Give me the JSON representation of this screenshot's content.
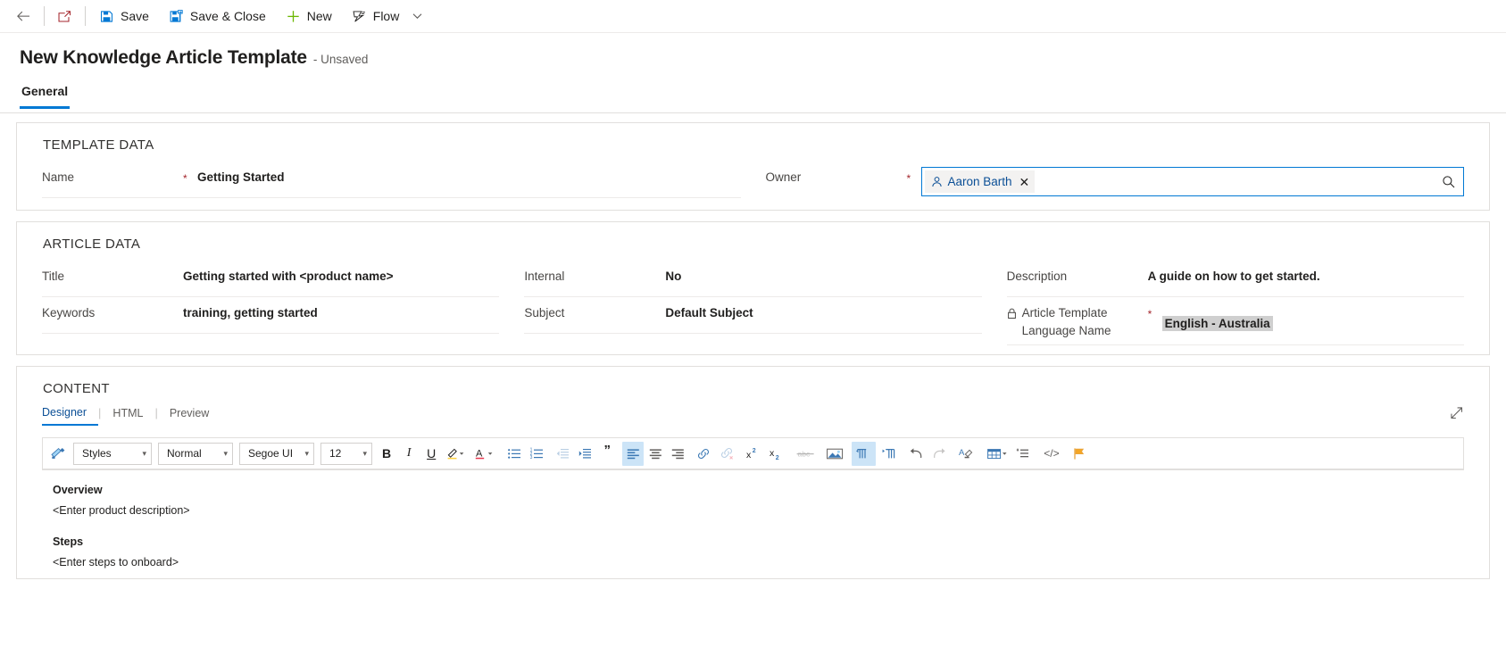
{
  "commandbar": {
    "back_label": "back-arrow",
    "popout_label": "open-in-new-window",
    "save_label": "Save",
    "save_close_label": "Save & Close",
    "new_label": "New",
    "flow_label": "Flow",
    "overflow_label": "chevron-down"
  },
  "record": {
    "title": "New Knowledge Article Template",
    "status": "- Unsaved"
  },
  "tabs": [
    {
      "label": "General",
      "active": true
    }
  ],
  "template_data": {
    "section_title": "TEMPLATE DATA",
    "name_label": "Name",
    "name_value": "Getting Started",
    "name_required": "*",
    "owner_label": "Owner",
    "owner_required": "*",
    "owner_value": "Aaron Barth",
    "owner_clear": "✕"
  },
  "article_data": {
    "section_title": "ARTICLE DATA",
    "title_label": "Title",
    "title_value": "Getting started with <product name>",
    "keywords_label": "Keywords",
    "keywords_value": "training, getting started",
    "internal_label": "Internal",
    "internal_value": "No",
    "subject_label": "Subject",
    "subject_value": "Default Subject",
    "description_label": "Description",
    "description_value": "A guide on how to get started.",
    "language_label_line1": "Article Template",
    "language_label_line2": "Language Name",
    "language_required": "*",
    "language_value": "English - Australia"
  },
  "content": {
    "section_title": "CONTENT",
    "editor_tabs": [
      {
        "label": "Designer",
        "active": true
      },
      {
        "label": "HTML",
        "active": false
      },
      {
        "label": "Preview",
        "active": false
      }
    ],
    "tab_divider": "|",
    "toolbar": {
      "format_painter": "format-painter",
      "styles": "Styles",
      "paragraph_format": "Normal",
      "font_family": "Segoe UI",
      "font_size": "12",
      "bold": "B",
      "italic": "I",
      "underline": "U",
      "highlight": "highlight",
      "font_color": "A",
      "bulleted_list": "bulleted-list",
      "numbered_list": "numbered-list",
      "decrease_indent": "decrease-indent",
      "increase_indent": "increase-indent",
      "blockquote": "”",
      "align_left": "align-left",
      "align_center": "align-center",
      "align_right": "align-right",
      "insert_link": "insert-link",
      "remove_link": "remove-link",
      "superscript": "x²",
      "subscript": "x₂",
      "strikethrough": "abc",
      "insert_image": "insert-image",
      "ltr": "left-to-right",
      "rtl": "right-to-left",
      "undo": "undo",
      "redo": "redo",
      "clear_format": "clear-formatting",
      "table": "insert-table",
      "line_spacing": "line-spacing",
      "code": "</>",
      "flag": "flag"
    },
    "document": {
      "overview_heading": "Overview",
      "overview_text": "<Enter product description>",
      "steps_heading": "Steps",
      "steps_text": "<Enter steps to onboard>"
    },
    "expand_label": "expand-editor"
  },
  "colors": {
    "accent": "#0078d4",
    "required": "#a4262c",
    "link": "#0b4f96",
    "toolbar_active_bg": "#cce4f7",
    "highlight_bg": "#cfcfcf",
    "new_icon": "#6bb700"
  }
}
